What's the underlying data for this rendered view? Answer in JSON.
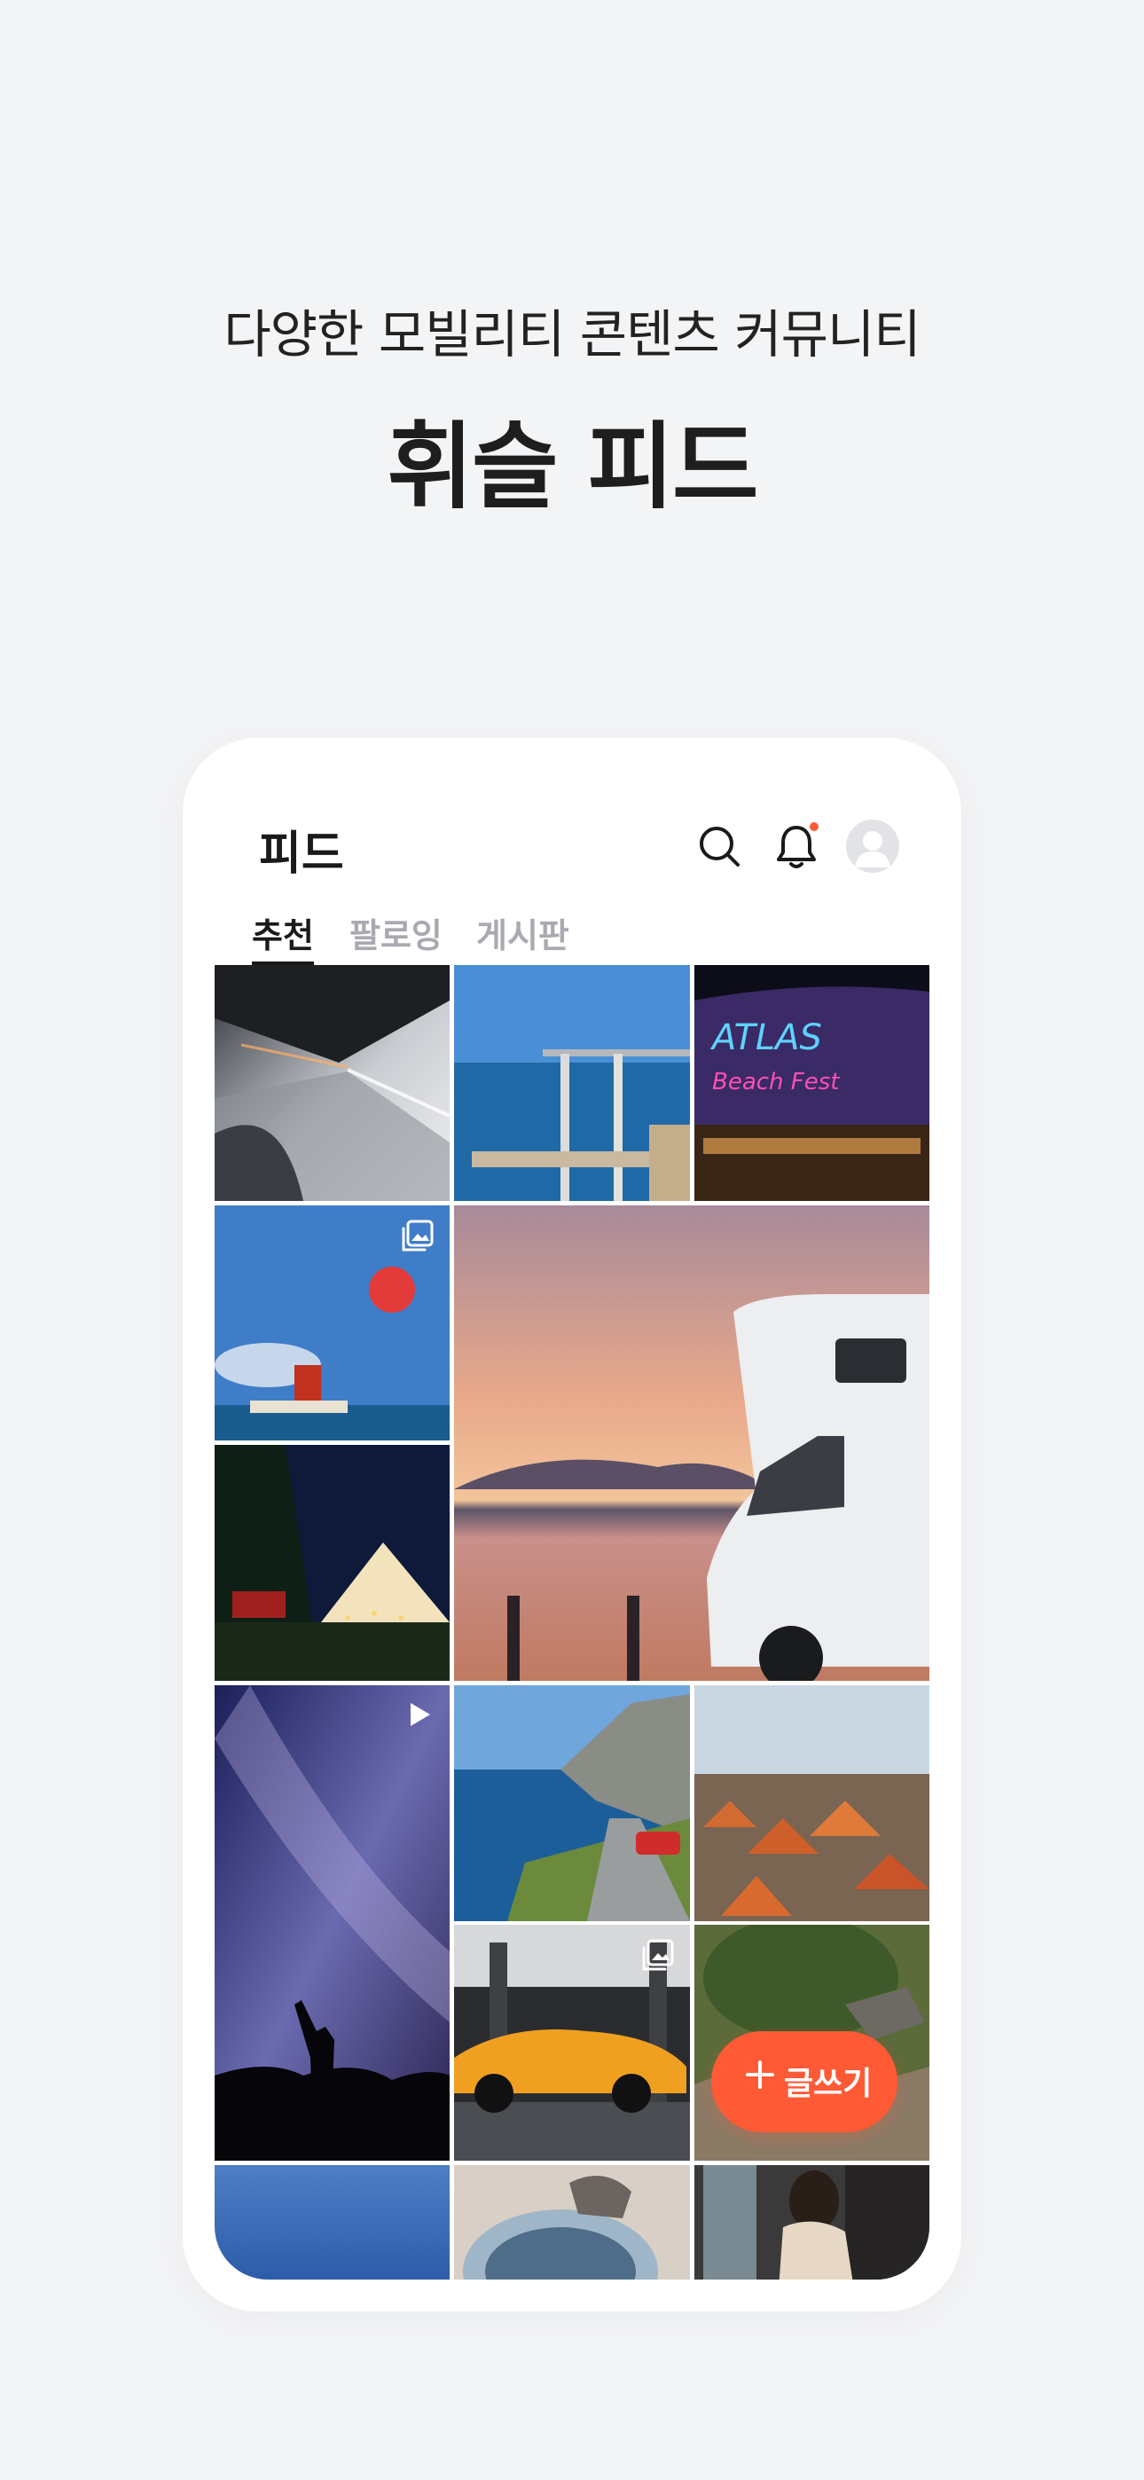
{
  "promo": {
    "subtitle": "다양한 모빌리티 콘텐츠 커뮤니티",
    "title": "휘슬 피드"
  },
  "header": {
    "title": "피드",
    "icons": [
      "search-icon",
      "bell-icon",
      "avatar"
    ]
  },
  "tabs": [
    {
      "label": "추천",
      "active": true
    },
    {
      "label": "팔로잉",
      "active": false
    },
    {
      "label": "게시판",
      "active": false
    }
  ],
  "fab": {
    "label": "글쓰기",
    "icon": "plus-icon"
  },
  "colors": {
    "background": "#f3f4f6",
    "accent": "#ff5a36",
    "notification_dot": "#ff5a36",
    "tab_active": "#1a1a1a",
    "tab_inactive": "#a8aab0"
  },
  "feed_tiles": [
    {
      "subject": "tunnel-car-motion",
      "badge": null
    },
    {
      "subject": "sea-pier",
      "badge": null
    },
    {
      "subject": "atlas-neon-building",
      "badge": null
    },
    {
      "subject": "hot-air-balloon-boat",
      "badge": "multi-image-icon"
    },
    {
      "subject": "camper-van-sunset",
      "badge": null
    },
    {
      "subject": "glamping-tent-night",
      "badge": null
    },
    {
      "subject": "milky-way-person",
      "badge": "play-icon"
    },
    {
      "subject": "coastal-road-red-car",
      "badge": null
    },
    {
      "subject": "red-roof-old-town",
      "badge": null
    },
    {
      "subject": "yellow-lamborghini-showroom",
      "badge": "multi-image-icon"
    },
    {
      "subject": "rocky-garden",
      "badge": null
    },
    {
      "subject": "blue-sky",
      "badge": null
    },
    {
      "subject": "glass-dome-figure",
      "badge": null
    },
    {
      "subject": "woman-phone-selfie",
      "badge": null
    }
  ]
}
